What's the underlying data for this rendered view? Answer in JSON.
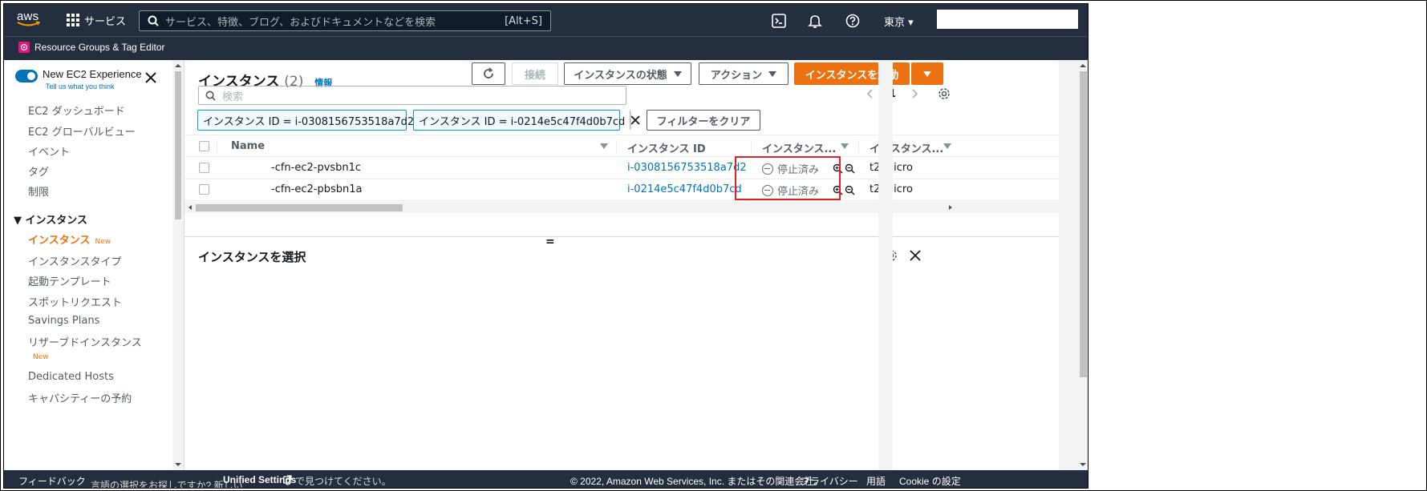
{
  "topnav": {
    "logo_text": "aws",
    "services_label": "サービス",
    "search_placeholder": "サービス、特徴、ブログ、およびドキュメントなどを検索",
    "search_shortcut": "[Alt+S]",
    "region": "東京 ▾"
  },
  "favorites": {
    "item": "Resource Groups & Tag Editor"
  },
  "sidebar": {
    "toggle_title": "New EC2 Experience",
    "toggle_sub": "Tell us what you think",
    "links_top": [
      "EC2 ダッシュボード",
      "EC2 グローバルビュー",
      "イベント",
      "タグ",
      "制限"
    ],
    "section": "▼ インスタンス",
    "active": "インスタンス",
    "active_badge": "New",
    "links_instances": [
      "インスタンスタイプ",
      "起動テンプレート",
      "スポットリクエスト",
      "Savings Plans",
      "リザーブドインスタンス"
    ],
    "reserved_badge": "New",
    "links_bottom": [
      "Dedicated Hosts",
      "キャパシティーの予約"
    ]
  },
  "panel": {
    "title": "インスタンス",
    "count": "(2)",
    "info": "情報",
    "connect": "接続",
    "state_btn": "インスタンスの状態",
    "actions_btn": "アクション",
    "launch_btn": "インスタンスを起動",
    "search_placeholder": "検索",
    "page": "1",
    "tokens": [
      "インスタンス ID = i-0308156753518a7d2",
      "インスタンス ID = i-0214e5c47f4d0b7cd"
    ],
    "clear_filters": "フィルターをクリア"
  },
  "table": {
    "headers": [
      "Name",
      "インスタンス ID",
      "インスタンス...",
      "インスタンス..."
    ],
    "rows": [
      {
        "name": "-cfn-ec2-pvsbn1c",
        "id": "i-0308156753518a7d2",
        "state": "停止済み",
        "type": "t2.micro"
      },
      {
        "name": "-cfn-ec2-pbsbn1a",
        "id": "i-0214e5c47f4d0b7cd",
        "state": "停止済み",
        "type": "t2.micro"
      }
    ]
  },
  "detail": {
    "grip": "=",
    "title": "インスタンスを選択"
  },
  "footer": {
    "feedback": "フィードバック",
    "lang_prefix": "言語の選択をお探しですか? 新しい",
    "lang_link": "Unified Settings",
    "lang_suffix": "で見つけてください。",
    "copyright": "© 2022, Amazon Web Services, Inc. またはその関連会社。",
    "privacy": "プライバシー",
    "terms": "用語",
    "cookie": "Cookie の設定"
  },
  "colors": {
    "nav_bg": "#232f3e",
    "accent": "#ec7211",
    "link": "#0073bb",
    "highlight": "#e31e24"
  }
}
